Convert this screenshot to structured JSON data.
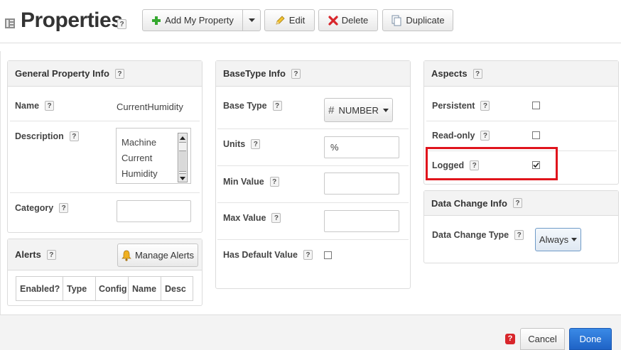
{
  "header": {
    "title": "Properties",
    "help": "?",
    "buttons": {
      "add": "Add My Property",
      "edit": "Edit",
      "delete": "Delete",
      "duplicate": "Duplicate"
    }
  },
  "general": {
    "title": "General Property Info",
    "name_label": "Name",
    "name_value": "CurrentHumidity",
    "description_label": "Description",
    "description_lines": [
      "Machine",
      "Current",
      "Humidity"
    ],
    "category_label": "Category",
    "category_value": ""
  },
  "alerts": {
    "title": "Alerts",
    "manage_label": "Manage Alerts",
    "columns": [
      "Enabled?",
      "Type",
      "Config",
      "Name",
      "Desc"
    ]
  },
  "basetype": {
    "title": "BaseType Info",
    "base_type_label": "Base Type",
    "base_type_symbol": "#",
    "base_type_value": "NUMBER",
    "units_label": "Units",
    "units_value": "%",
    "min_label": "Min Value",
    "min_value": "",
    "max_label": "Max Value",
    "max_value": "",
    "default_label": "Has Default Value",
    "default_checked": false
  },
  "aspects": {
    "title": "Aspects",
    "persistent_label": "Persistent",
    "persistent_checked": false,
    "readonly_label": "Read-only",
    "readonly_checked": false,
    "logged_label": "Logged",
    "logged_checked": true,
    "highlight_color": "#e0141c"
  },
  "datachange": {
    "title": "Data Change Info",
    "type_label": "Data Change Type",
    "type_value": "Always"
  },
  "footer": {
    "error_badge": "?",
    "cancel_label": "Cancel",
    "done_label": "Done"
  },
  "colors": {
    "add_green": "#35a82f",
    "delete_red": "#d8262b",
    "done_blue": "#1f73d9",
    "footer_bg": "#f3f3f3"
  }
}
